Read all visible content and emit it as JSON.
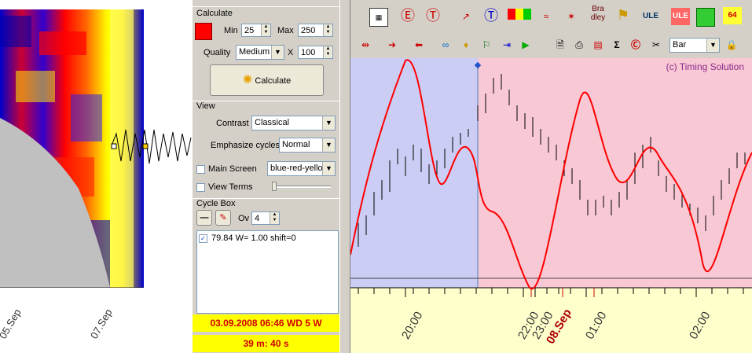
{
  "spectrum": {
    "tick_labels": [
      "05.Sep",
      "07.Sep"
    ],
    "colors": {
      "red": "#ff0000",
      "yellow": "#ffff00",
      "blue": "#0000cc",
      "gray": "#c0c0c0"
    }
  },
  "calculate": {
    "title": "Calculate",
    "color_swatch": "#ff0000",
    "min_label": "Min",
    "min_value": "25",
    "max_label": "Max",
    "max_value": "250",
    "quality_label": "Quality",
    "quality_value": "Medium",
    "x_label": "X",
    "x_value": "100",
    "button_label": "Calculate"
  },
  "view": {
    "title": "View",
    "contrast_label": "Contrast",
    "contrast_value": "Classical",
    "emphasize_label": "Emphasize cycles",
    "emphasize_value": "Normal",
    "main_screen_label": "Main Screen",
    "main_screen_value": "blue-red-yellow",
    "view_terms_label": "View Terms"
  },
  "cycle_box": {
    "title": "Cycle Box",
    "ov_label": "Ov",
    "ov_value": "4",
    "items": [
      {
        "text": "79.84  W= 1.00  shift=0",
        "checked": true
      }
    ]
  },
  "status": {
    "line1": "03.09.2008   06:46 WD   5 W",
    "line2": "39 m: 40 s"
  },
  "toolbar": {
    "row1_text_icons": [
      "Bra dley",
      "ULE",
      "ULE",
      "64"
    ],
    "bar_combo_value": "Bar"
  },
  "chart": {
    "watermark": "(c) Timing Solution",
    "x_labels": [
      "20:00",
      "22:00",
      "23:00",
      "08.Sep",
      "01:00",
      "02:00"
    ],
    "colors": {
      "past_bg": "#cccdf5",
      "future_bg": "#f8c8d4",
      "line": "#ff0000",
      "axis_bg": "#ffffcc"
    }
  }
}
